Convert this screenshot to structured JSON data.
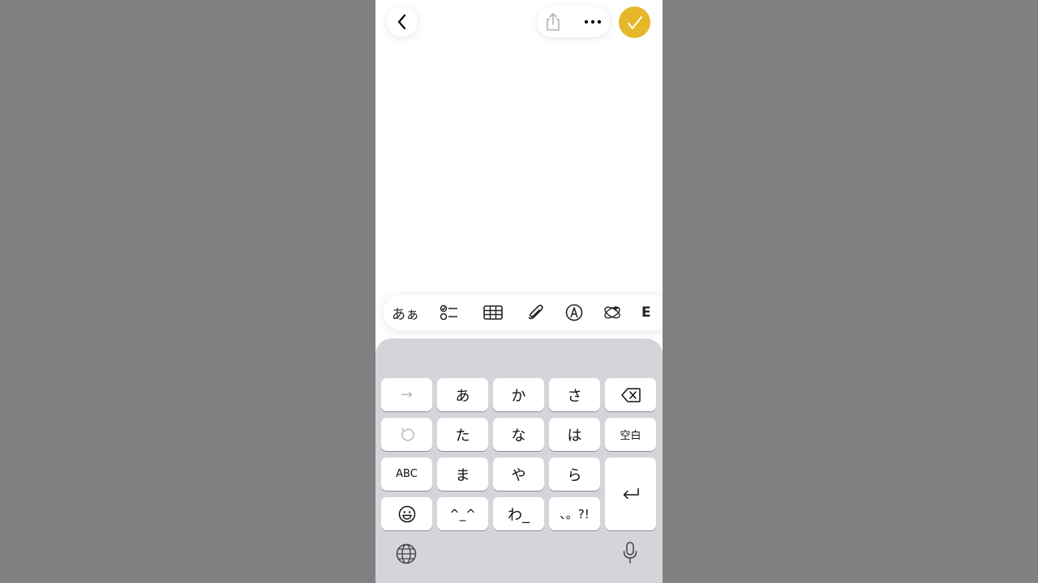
{
  "top_bar": {
    "back_icon": "chevron-left-icon",
    "share_icon": "share-icon",
    "more_icon": "ellipsis-icon",
    "done_icon": "checkmark-icon",
    "done_color": "#E6B829"
  },
  "toolbar": {
    "format_label": "あぁ",
    "checklist_icon": "checklist-icon",
    "table_icon": "table-icon",
    "attach_icon": "paperclip-icon",
    "markup_icon": "markup-pen-icon",
    "ai_icon": "writing-tools-icon",
    "partial_label": "E"
  },
  "keyboard": {
    "row1": {
      "arrow": "→",
      "a": "あ",
      "ka": "か",
      "sa": "さ"
    },
    "row2": {
      "ta": "た",
      "na": "な",
      "ha": "は",
      "space": "空白"
    },
    "row3": {
      "abc": "ABC",
      "ma": "ま",
      "ya": "や",
      "ra": "ら"
    },
    "row4": {
      "kaomoji": "^_^",
      "wa": "わ_",
      "punct": "、。?!"
    },
    "icons": {
      "delete": "backspace-icon",
      "undo": "undo-icon",
      "return": "return-icon",
      "emoji": "emoji-icon",
      "globe": "globe-icon",
      "mic": "microphone-icon"
    }
  },
  "colors": {
    "background": "#818181",
    "keyboard_bg": "#D3D5DB",
    "key_bg": "#FFFFFF"
  }
}
